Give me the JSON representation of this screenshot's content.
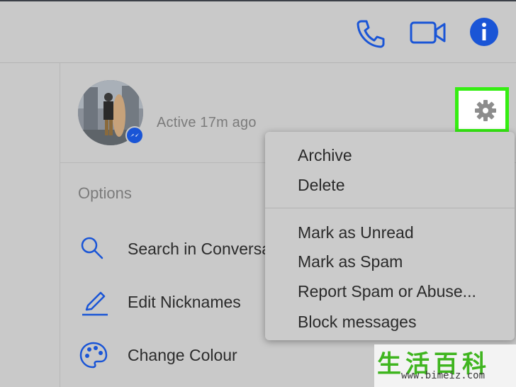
{
  "header": {
    "icons": [
      "phone-icon",
      "video-camera-icon",
      "info-icon"
    ],
    "accent_color": "#1a55d6"
  },
  "profile": {
    "status": "Active 17m ago",
    "badge_icon": "messenger-icon"
  },
  "settings": {
    "icon": "gear-icon",
    "highlight_color": "#35ee12"
  },
  "options": {
    "title": "Options",
    "items": [
      {
        "label": "Search in Conversa",
        "icon": "search-icon"
      },
      {
        "label": "Edit Nicknames",
        "icon": "pencil-icon"
      },
      {
        "label": "Change Colour",
        "icon": "palette-icon"
      }
    ]
  },
  "menu": {
    "group1": [
      "Archive",
      "Delete"
    ],
    "group2": [
      "Mark as Unread",
      "Mark as Spam",
      "Report Spam or Abuse...",
      "Block messages"
    ]
  },
  "watermark": {
    "chars": "生活百科",
    "url": "www.bimeiz.com"
  }
}
